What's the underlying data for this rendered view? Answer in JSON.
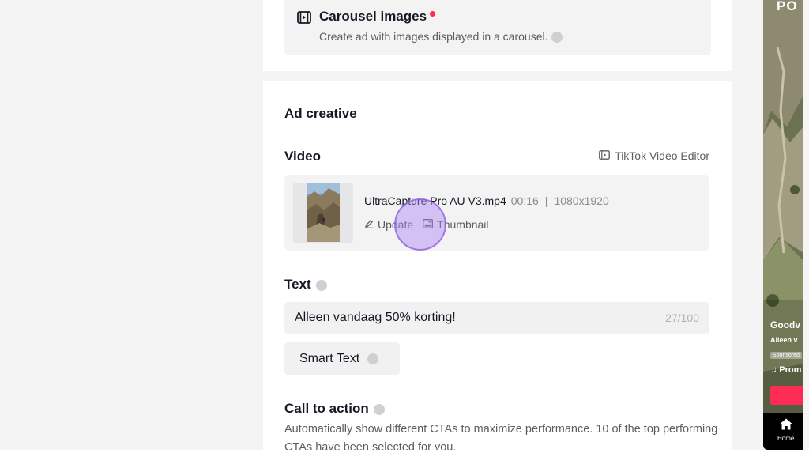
{
  "carousel": {
    "title": "Carousel images",
    "description": "Create ad with images displayed in a carousel."
  },
  "section": {
    "title": "Ad creative"
  },
  "video": {
    "label": "Video",
    "editor_link": "TikTok Video Editor",
    "file_name": "UltraCapture Pro AU V3.mp4",
    "duration": "00:16",
    "separator": "|",
    "resolution": "1080x1920",
    "update_label": "Update",
    "thumbnail_label": "Thumbnail"
  },
  "text_field": {
    "label": "Text",
    "value": "Alleen vandaag 50% korting!",
    "counter": "27/100"
  },
  "smart_text": {
    "label": "Smart Text"
  },
  "cta": {
    "label": "Call to action",
    "description": "Automatically show different CTAs to maximize performance. 10 of the top performing CTAs have been selected for you."
  },
  "preview": {
    "top_text": "PO",
    "account": "Goodv",
    "caption": "Alleen v",
    "sponsored": "Sponsored",
    "music": "♫ Prom",
    "home_label": "Home"
  },
  "colors": {
    "accent": "#fe2c55",
    "click_indicator": "#ab86f0",
    "card_bg": "#f3f3f4"
  }
}
